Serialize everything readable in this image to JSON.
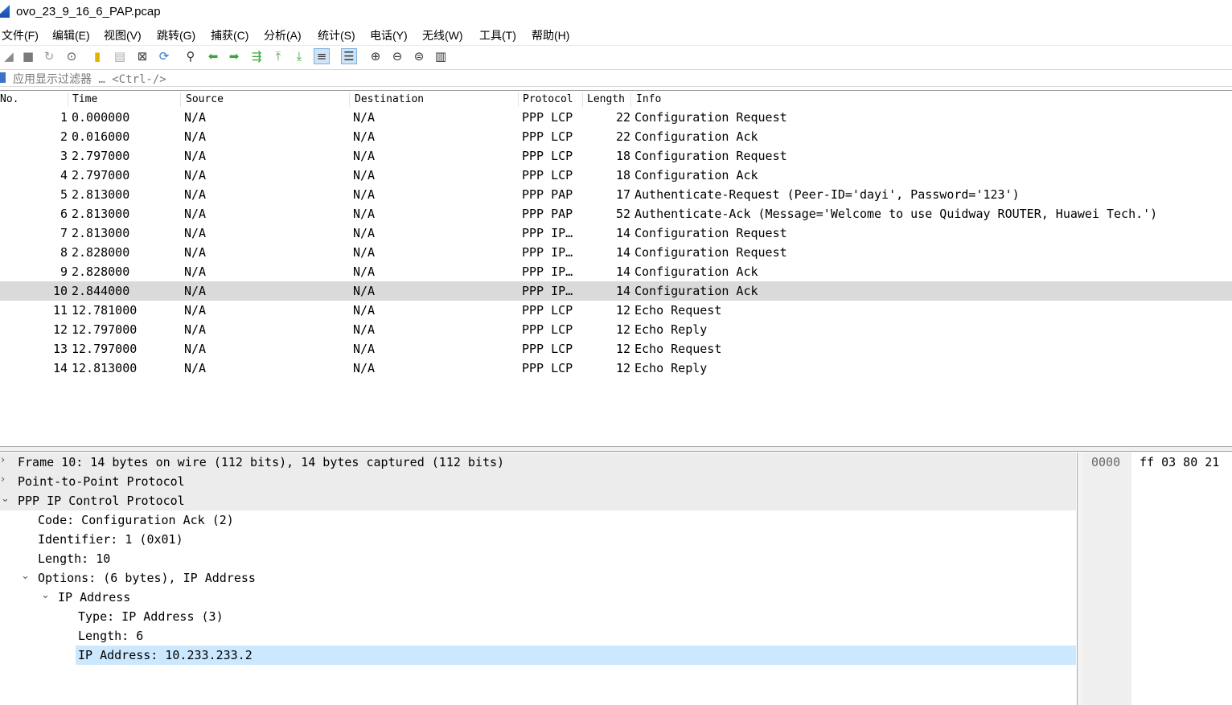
{
  "window": {
    "title": "ovo_23_9_16_6_PAP.pcap"
  },
  "menu": [
    "文件(F)",
    "编辑(E)",
    "视图(V)",
    "跳转(G)",
    "捕获(C)",
    "分析(A)",
    "统计(S)",
    "电话(Y)",
    "无线(W)",
    "工具(T)",
    "帮助(H)"
  ],
  "toolbar": {
    "icons": [
      "shark-start-icon",
      "stop-icon",
      "restart-icon",
      "options-icon",
      "open-icon",
      "save-icon",
      "close-file-icon",
      "reload-icon",
      "find-icon",
      "back-icon",
      "forward-icon",
      "goto-icon",
      "first-packet-icon",
      "last-packet-icon",
      "autoscroll-icon",
      "colorize-icon",
      "zoom-in-icon",
      "zoom-out-icon",
      "zoom-reset-icon",
      "resize-columns-icon"
    ]
  },
  "filter": {
    "placeholder": "应用显示过滤器 … <Ctrl-/>"
  },
  "columns": {
    "no": "No.",
    "time": "Time",
    "source": "Source",
    "destination": "Destination",
    "protocol": "Protocol",
    "length": "Length",
    "info": "Info"
  },
  "packets": [
    {
      "no": "1",
      "time": "0.000000",
      "src": "N/A",
      "dst": "N/A",
      "proto": "PPP LCP",
      "len": "22",
      "info": "Configuration Request"
    },
    {
      "no": "2",
      "time": "0.016000",
      "src": "N/A",
      "dst": "N/A",
      "proto": "PPP LCP",
      "len": "22",
      "info": "Configuration Ack"
    },
    {
      "no": "3",
      "time": "2.797000",
      "src": "N/A",
      "dst": "N/A",
      "proto": "PPP LCP",
      "len": "18",
      "info": "Configuration Request"
    },
    {
      "no": "4",
      "time": "2.797000",
      "src": "N/A",
      "dst": "N/A",
      "proto": "PPP LCP",
      "len": "18",
      "info": "Configuration Ack"
    },
    {
      "no": "5",
      "time": "2.813000",
      "src": "N/A",
      "dst": "N/A",
      "proto": "PPP PAP",
      "len": "17",
      "info": "Authenticate-Request (Peer-ID='dayi', Password='123')"
    },
    {
      "no": "6",
      "time": "2.813000",
      "src": "N/A",
      "dst": "N/A",
      "proto": "PPP PAP",
      "len": "52",
      "info": "Authenticate-Ack (Message='Welcome to use Quidway ROUTER, Huawei Tech.')"
    },
    {
      "no": "7",
      "time": "2.813000",
      "src": "N/A",
      "dst": "N/A",
      "proto": "PPP IP…",
      "len": "14",
      "info": "Configuration Request"
    },
    {
      "no": "8",
      "time": "2.828000",
      "src": "N/A",
      "dst": "N/A",
      "proto": "PPP IP…",
      "len": "14",
      "info": "Configuration Request"
    },
    {
      "no": "9",
      "time": "2.828000",
      "src": "N/A",
      "dst": "N/A",
      "proto": "PPP IP…",
      "len": "14",
      "info": "Configuration Ack"
    },
    {
      "no": "10",
      "time": "2.844000",
      "src": "N/A",
      "dst": "N/A",
      "proto": "PPP IP…",
      "len": "14",
      "info": "Configuration Ack"
    },
    {
      "no": "11",
      "time": "12.781000",
      "src": "N/A",
      "dst": "N/A",
      "proto": "PPP LCP",
      "len": "12",
      "info": "Echo Request"
    },
    {
      "no": "12",
      "time": "12.797000",
      "src": "N/A",
      "dst": "N/A",
      "proto": "PPP LCP",
      "len": "12",
      "info": "Echo Reply"
    },
    {
      "no": "13",
      "time": "12.797000",
      "src": "N/A",
      "dst": "N/A",
      "proto": "PPP LCP",
      "len": "12",
      "info": "Echo Request"
    },
    {
      "no": "14",
      "time": "12.813000",
      "src": "N/A",
      "dst": "N/A",
      "proto": "PPP LCP",
      "len": "12",
      "info": "Echo Reply"
    }
  ],
  "selected_packet": "10",
  "details": [
    {
      "text": "Frame 10: 14 bytes on wire (112 bits), 14 bytes captured (112 bits)",
      "arrow": "›",
      "level": 0
    },
    {
      "text": "Point-to-Point Protocol",
      "arrow": "›",
      "level": 0
    },
    {
      "text": "PPP IP Control Protocol",
      "arrow": "⌄",
      "level": 0
    },
    {
      "text": "Code: Configuration Ack (2)",
      "arrow": "",
      "level": 1
    },
    {
      "text": "Identifier: 1 (0x01)",
      "arrow": "",
      "level": 1
    },
    {
      "text": "Length: 10",
      "arrow": "",
      "level": 1
    },
    {
      "text": "Options: (6 bytes), IP Address",
      "arrow": "⌄",
      "level": 1
    },
    {
      "text": "IP Address",
      "arrow": "⌄",
      "level": 2
    },
    {
      "text": "Type: IP Address (3)",
      "arrow": "",
      "level": 3
    },
    {
      "text": "Length: 6",
      "arrow": "",
      "level": 3
    },
    {
      "text": "IP Address: 10.233.233.2",
      "arrow": "",
      "level": 3
    }
  ],
  "bytes": {
    "offset": "0000",
    "hex": "ff 03 80 21"
  }
}
